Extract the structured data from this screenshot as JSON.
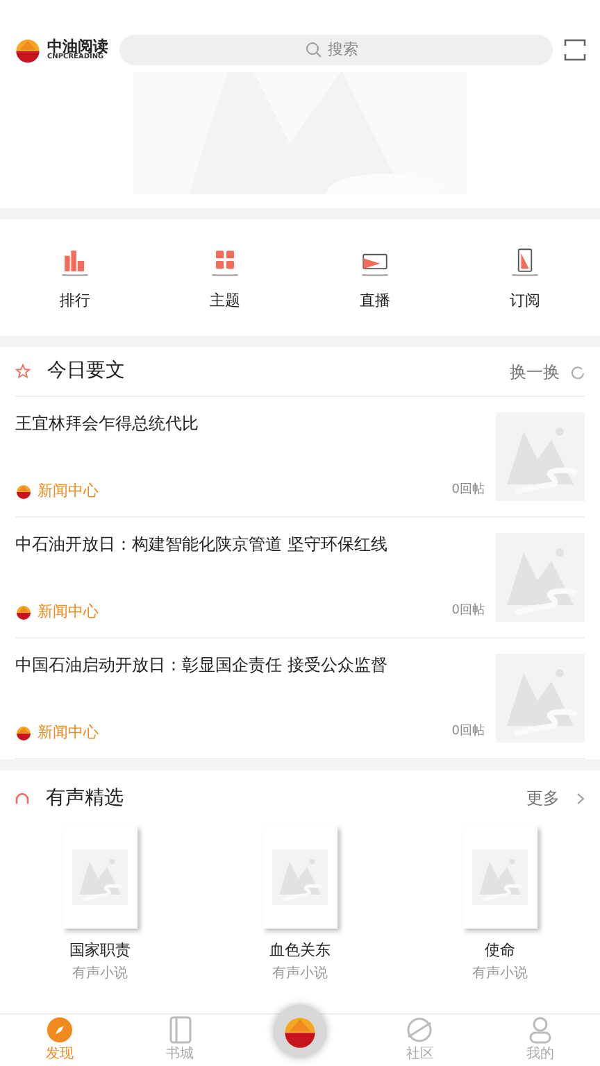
{
  "header": {
    "logo_title": "中油阅读",
    "logo_subtitle": "CNPCREADING",
    "search": {
      "placeholder": "搜索"
    }
  },
  "shortcuts": [
    {
      "label": "排行",
      "kind": "ranking"
    },
    {
      "label": "主题",
      "kind": "topics"
    },
    {
      "label": "直播",
      "kind": "live"
    },
    {
      "label": "订阅",
      "kind": "subscribe"
    }
  ],
  "today": {
    "title": "今日要文",
    "action": "换一换",
    "articles": [
      {
        "title": "王宜林拜会乍得总统代比",
        "source": "新闻中心",
        "replies": "0回帖"
      },
      {
        "title": "中石油开放日：构建智能化陕京管道 坚守环保红线",
        "source": "新闻中心",
        "replies": "0回帖"
      },
      {
        "title": "中国石油启动开放日：彰显国企责任 接受公众监督",
        "source": "新闻中心",
        "replies": "0回帖"
      }
    ]
  },
  "audio": {
    "title": "有声精选",
    "action": "更多",
    "books": [
      {
        "title": "国家职责",
        "category": "有声小说"
      },
      {
        "title": "血色关东",
        "category": "有声小说"
      },
      {
        "title": "使命",
        "category": "有声小说"
      }
    ]
  },
  "nav": [
    {
      "kind": "tab",
      "label": "发现",
      "selected": true
    },
    {
      "kind": "tab",
      "label": "书城",
      "selected": false
    },
    {
      "kind": "center",
      "selected": false
    },
    {
      "kind": "tab",
      "label": "社区",
      "selected": false
    },
    {
      "kind": "tab",
      "label": "我的",
      "selected": false
    }
  ]
}
